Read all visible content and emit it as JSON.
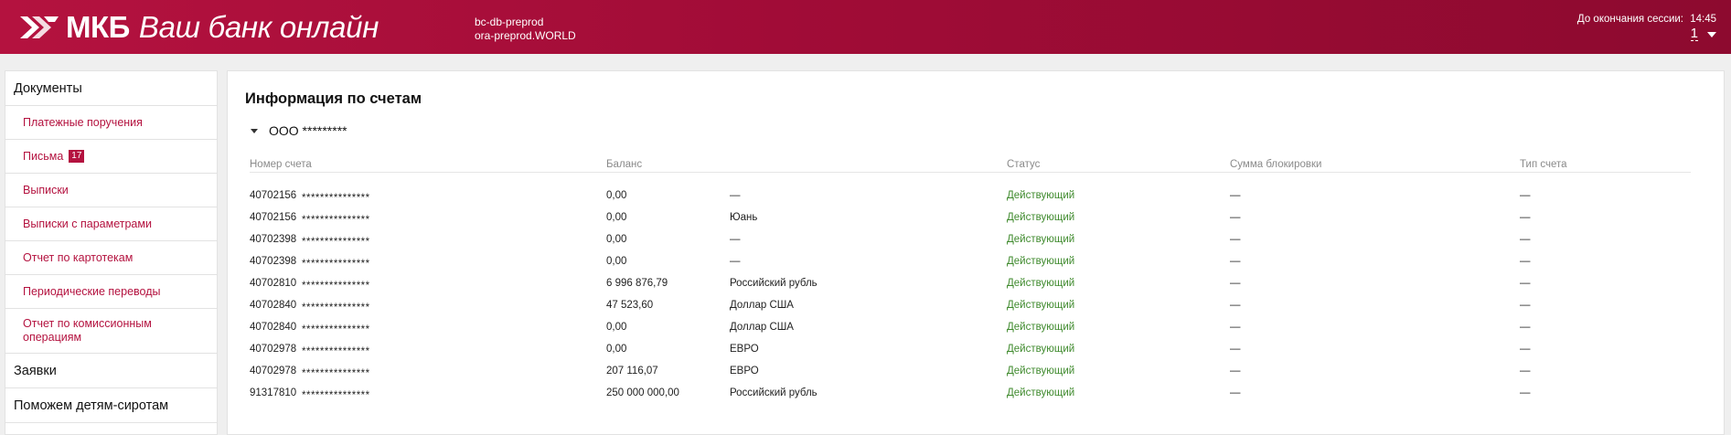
{
  "header": {
    "brand": "МКБ",
    "slogan": "Ваш банк онлайн",
    "db": "bc-db-preprod",
    "ora": "ora-preprod.WORLD",
    "session_label": "До окончания сессии:",
    "session_time": "14:45",
    "user_number": "1",
    "colors": {
      "brand": "#b4123f",
      "brand_dark": "#8d0a2f"
    },
    "icons": {
      "logo": "mkb-logo-icon",
      "user_menu": "chevron-down-icon"
    }
  },
  "sidebar": {
    "sections": [
      {
        "label": "Документы",
        "items": [
          {
            "label": "Платежные поручения"
          },
          {
            "label": "Письма",
            "badge": "17"
          },
          {
            "label": "Выписки"
          },
          {
            "label": "Выписки с параметрами"
          },
          {
            "label": "Отчет по картотекам"
          },
          {
            "label": "Периодические переводы"
          },
          {
            "label": "Отчет по комиссионным операциям"
          }
        ]
      },
      {
        "label": "Заявки"
      },
      {
        "label": "Поможем детям-сиротам"
      }
    ]
  },
  "main": {
    "heading": "Информация по счетам",
    "group": {
      "name": "ООО *********",
      "icon": "caret-down-icon"
    },
    "columns": {
      "account": "Номер счета",
      "balance": "Баланс",
      "status": "Статус",
      "blocked": "Сумма блокировки",
      "type": "Тип счета"
    },
    "rows": [
      {
        "account": "40702156",
        "mask": "***************",
        "balance": "0,00",
        "currency": "—",
        "status": "Действующий",
        "blocked": "—",
        "type": "—"
      },
      {
        "account": "40702156",
        "mask": "***************",
        "balance": "0,00",
        "currency": "Юань",
        "status": "Действующий",
        "blocked": "—",
        "type": "—"
      },
      {
        "account": "40702398",
        "mask": "***************",
        "balance": "0,00",
        "currency": "—",
        "status": "Действующий",
        "blocked": "—",
        "type": "—"
      },
      {
        "account": "40702398",
        "mask": "***************",
        "balance": "0,00",
        "currency": "—",
        "status": "Действующий",
        "blocked": "—",
        "type": "—"
      },
      {
        "account": "40702810",
        "mask": "***************",
        "balance": "6 996 876,79",
        "currency": "Российский рубль",
        "status": "Действующий",
        "blocked": "—",
        "type": "—"
      },
      {
        "account": "40702840",
        "mask": "***************",
        "balance": "47 523,60",
        "currency": "Доллар США",
        "status": "Действующий",
        "blocked": "—",
        "type": "—"
      },
      {
        "account": "40702840",
        "mask": "***************",
        "balance": "0,00",
        "currency": "Доллар США",
        "status": "Действующий",
        "blocked": "—",
        "type": "—"
      },
      {
        "account": "40702978",
        "mask": "***************",
        "balance": "0,00",
        "currency": "ЕВРО",
        "status": "Действующий",
        "blocked": "—",
        "type": "—"
      },
      {
        "account": "40702978",
        "mask": "***************",
        "balance": "207 116,07",
        "currency": "ЕВРО",
        "status": "Действующий",
        "blocked": "—",
        "type": "—"
      },
      {
        "account": "91317810",
        "mask": "***************",
        "balance": "250 000 000,00",
        "currency": "Российский рубль",
        "status": "Действующий",
        "blocked": "—",
        "type": "—"
      }
    ],
    "status_color": "#3f8a2d"
  }
}
